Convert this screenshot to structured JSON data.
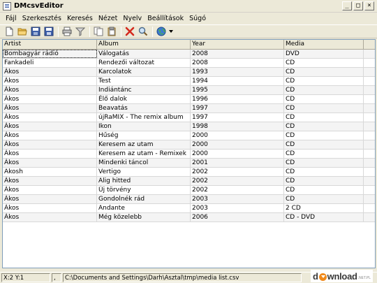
{
  "window": {
    "title": "DMcsvEditor"
  },
  "window_buttons": {
    "minimize": "_",
    "maximize": "□",
    "close": "×"
  },
  "menu": [
    "Fájl",
    "Szerkesztés",
    "Keresés",
    "Nézet",
    "Nyelv",
    "Beállítások",
    "Súgó"
  ],
  "toolbar": {
    "icons": [
      "new-file-icon",
      "open-folder-icon",
      "save-icon",
      "save-as-icon",
      "print-icon",
      "filter-icon",
      "copy-icon",
      "paste-icon",
      "delete-icon",
      "search-icon",
      "globe-icon",
      "dropdown-arrow-icon"
    ]
  },
  "table": {
    "columns": [
      "Artist",
      "Album",
      "Year",
      "Media"
    ],
    "rows": [
      [
        "Bombagyár rádió",
        "Válogatás",
        "2008",
        "DVD"
      ],
      [
        "Fankadeli",
        "Rendezői változat",
        "2008",
        "CD"
      ],
      [
        "Ákos",
        "Karcolatok",
        "1993",
        "CD"
      ],
      [
        "Ákos",
        "Test",
        "1994",
        "CD"
      ],
      [
        "Ákos",
        "Indiántánc",
        "1995",
        "CD"
      ],
      [
        "Ákos",
        "Élő dalok",
        "1996",
        "CD"
      ],
      [
        "Ákos",
        "Beavatás",
        "1997",
        "CD"
      ],
      [
        "Ákos",
        "újRaMIX - The remix album",
        "1997",
        "CD"
      ],
      [
        "Ákos",
        "Ikon",
        "1998",
        "CD"
      ],
      [
        "Ákos",
        "Hűség",
        "2000",
        "CD"
      ],
      [
        "Ákos",
        "Keresem az utam",
        "2000",
        "CD"
      ],
      [
        "Ákos",
        "Keresem az utam - Remixek",
        "2000",
        "CD"
      ],
      [
        "Ákos",
        "Mindenki táncol",
        "2001",
        "CD"
      ],
      [
        "Akosh",
        "Vertigo",
        "2002",
        "CD"
      ],
      [
        "Ákos",
        "Alig hitted",
        "2002",
        "CD"
      ],
      [
        "Ákos",
        "Új törvény",
        "2002",
        "CD"
      ],
      [
        "Ákos",
        "Gondolnék rád",
        "2003",
        "CD"
      ],
      [
        "Ákos",
        "Andante",
        "2003",
        "2 CD"
      ],
      [
        "Ákos",
        "Még közelebb",
        "2006",
        "CD - DVD"
      ]
    ]
  },
  "status": {
    "position": "X:2  Y:1",
    "separator": ",",
    "path": "C:\\Documents and Settings\\Darh\\Asztal\\tmp\\media list.csv"
  },
  "watermark": {
    "text_left": "d",
    "text_right": "wnload",
    "suffix": ".NET.PL"
  }
}
